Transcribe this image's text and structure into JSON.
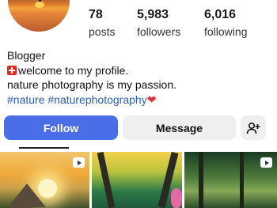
{
  "profile": {
    "stats": [
      {
        "value": "78",
        "label": "posts"
      },
      {
        "value": "5,983",
        "label": "followers"
      },
      {
        "value": "6,016",
        "label": "following"
      }
    ],
    "category": "Blogger",
    "bio_line1": "welcome to my profile.",
    "bio_line2": "nature photography is my passion.",
    "hashtags": "#nature #naturephotography",
    "flag_icon": "swiss-flag-icon",
    "heart_icon": "red-heart-icon"
  },
  "actions": {
    "follow_label": "Follow",
    "message_label": "Message",
    "add_user_icon": "add-person-icon"
  },
  "grid": {
    "items": [
      {
        "name": "sunset-mountain-photo",
        "reel": true
      },
      {
        "name": "colorful-forest-photo",
        "reel": false
      },
      {
        "name": "green-forest-photo",
        "reel": true
      }
    ]
  },
  "colors": {
    "accent": "#4a6ee8",
    "hashtag": "#2b5eb5",
    "button_bg": "#efefef"
  }
}
